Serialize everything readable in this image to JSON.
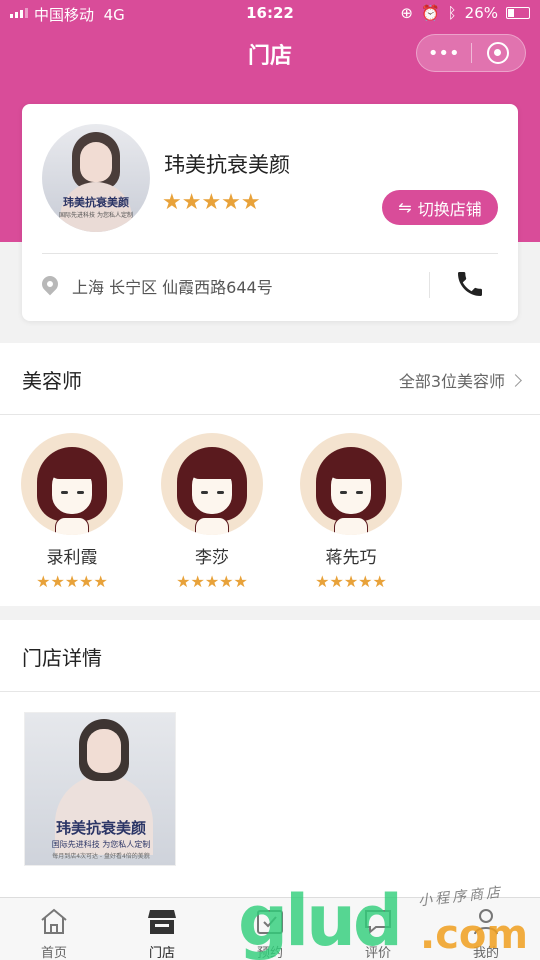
{
  "status_bar": {
    "carrier": "中国移动",
    "network": "4G",
    "time": "16:22",
    "battery": "26%",
    "battery_level": 0.26
  },
  "nav": {
    "title": "门店",
    "more_icon": "more-dots-icon",
    "close_icon": "target-icon"
  },
  "store": {
    "logo_text": "玮美抗衰美颜",
    "logo_subtext": "国际先进科技 为您私人定制",
    "name": "玮美抗衰美颜",
    "rating_stars": 5,
    "star_glyphs": "★★★★★",
    "switch_icon": "⇋",
    "switch_label": "切换店铺",
    "address": "上海 长宁区 仙霞西路644号",
    "accent_color": "#d94c99",
    "star_color": "#e8a23a"
  },
  "beauticians": {
    "title": "美容师",
    "more_label": "全部3位美容师",
    "items": [
      {
        "name": "录利霞",
        "stars": "★★★★★"
      },
      {
        "name": "李莎",
        "stars": "★★★★★"
      },
      {
        "name": "蒋先巧",
        "stars": "★★★★★"
      }
    ]
  },
  "details": {
    "title": "门店详情",
    "photo_title": "玮美抗衰美颜",
    "photo_sub": "国际先进科技 为您私人定制",
    "photo_sub2": "每月到店4次可达 - 盘好看4倍的美貌"
  },
  "tabbar": {
    "items": [
      {
        "label": "首页",
        "icon": "home-icon"
      },
      {
        "label": "门店",
        "icon": "store-icon"
      },
      {
        "label": "预约",
        "icon": "calendar-icon"
      },
      {
        "label": "评价",
        "icon": "comment-icon"
      },
      {
        "label": "我的",
        "icon": "user-icon"
      }
    ],
    "active_index": 1
  },
  "watermark": {
    "brand": "glud",
    "tld": ".com",
    "script": "小程序商店"
  }
}
